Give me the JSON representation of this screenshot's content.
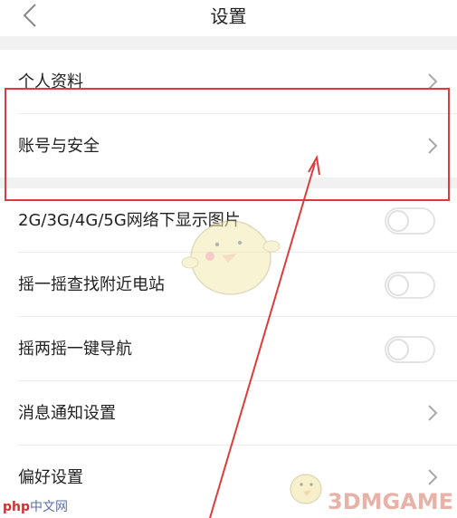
{
  "header": {
    "title": "设置",
    "back_icon": "chevron-left-icon"
  },
  "rows": [
    {
      "label": "个人资料",
      "control": "chevron"
    },
    {
      "label": "账号与安全",
      "control": "chevron"
    },
    {
      "label": "2G/3G/4G/5G网络下显示图片",
      "control": "toggle",
      "state": "off"
    },
    {
      "label": "摇一摇查找附近电站",
      "control": "toggle",
      "state": "off"
    },
    {
      "label": "摇两摇一键导航",
      "control": "toggle",
      "state": "off"
    },
    {
      "label": "消息通知设置",
      "control": "chevron"
    },
    {
      "label": "偏好设置",
      "control": "chevron"
    }
  ],
  "annotation": {
    "highlight_color": "#e03b3b",
    "highlighted_item": "账号与安全"
  },
  "watermarks": {
    "left_prefix": "php",
    "left_suffix": "中文网",
    "right": "3DMGAME"
  },
  "colors": {
    "background": "#ffffff",
    "section_gap": "#f1f1f1",
    "accent_red": "#e03b3b"
  }
}
